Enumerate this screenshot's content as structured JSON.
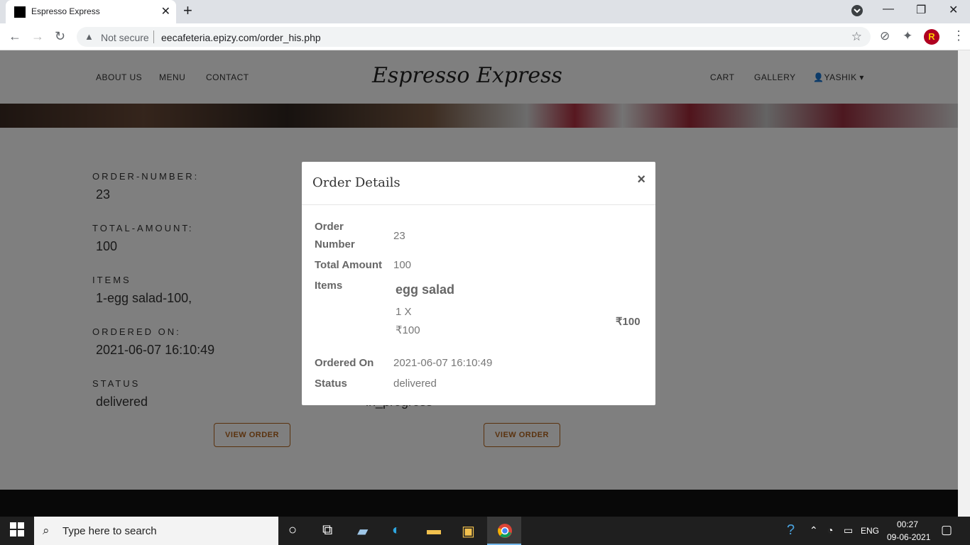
{
  "browser": {
    "tab_title": "Espresso Express",
    "tab_close": "✕",
    "new_tab": "+",
    "security_label": "Not secure",
    "url": "eecafeteria.epizy.com/order_his.php",
    "avatar_letter": "R"
  },
  "site": {
    "brand": "Espresso Express",
    "nav_left": [
      "ABOUT US",
      "MENU",
      "CONTACT"
    ],
    "nav_right": [
      "CART",
      "GALLERY"
    ],
    "user": "YASHIK"
  },
  "orders": [
    {
      "order_number_label": "ORDER-NUMBER:",
      "order_number": "23",
      "total_label": "TOTAL-AMOUNT:",
      "total": "100",
      "items_label": "ITEMS",
      "items": "1-egg salad-100,",
      "ordered_on_label": "ORDERED ON:",
      "ordered_on": "2021-06-07 16:10:49",
      "status_label": "STATUS",
      "status": "delivered",
      "button": "VIEW ORDER"
    },
    {
      "status": "in_progress",
      "button": "VIEW ORDER"
    }
  ],
  "modal": {
    "title": "Order Details",
    "close": "×",
    "order_number_label_1": "Order",
    "order_number_label_2": "Number",
    "order_number": "23",
    "total_label": "Total Amount",
    "total": "100",
    "items_label": "Items",
    "item_name": "egg salad",
    "item_qty": "1 X",
    "item_price": "₹100",
    "item_total": "₹100",
    "ordered_on_label": "Ordered On",
    "ordered_on": "2021-06-07 16:10:49",
    "status_label": "Status",
    "status": "delivered"
  },
  "taskbar": {
    "search_placeholder": "Type here to search",
    "lang": "ENG",
    "time": "00:27",
    "date": "09-06-2021"
  },
  "colors": {
    "accent": "#b5651d",
    "overlay": "rgba(0,0,0,0.5)"
  }
}
